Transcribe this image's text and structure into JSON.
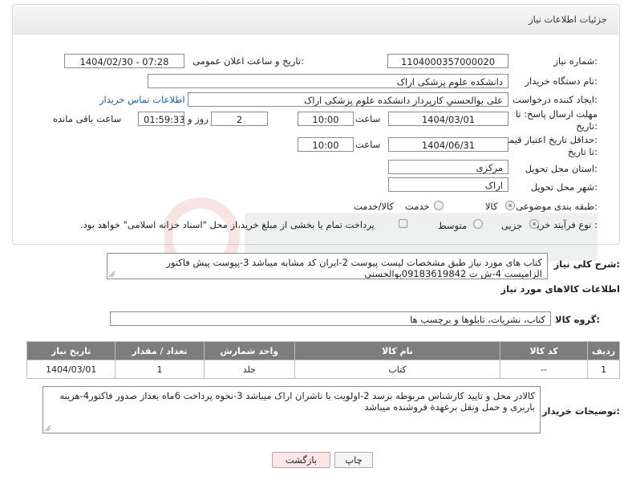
{
  "header": {
    "title": "جزئیات اطلاعات نیاز"
  },
  "form": {
    "need_number": {
      "label": "شماره نیاز:",
      "value": "1104000357000020"
    },
    "announce": {
      "label": "تاریخ و ساعت اعلان عمومی:",
      "value": "1404/02/30 - 07:28"
    },
    "buyer_org": {
      "label": "نام دستگاه خریدار:",
      "value": "دانشکده علوم پزشکی اراک"
    },
    "requester": {
      "label": "ایجاد کننده درخواست:",
      "value": "علی بوالحسني کارپرداز دانشکده علوم پزشکی اراک",
      "contact_link": "اطلاعات تماس خریدار"
    },
    "reply_deadline": {
      "label_line1": "مهلت ارسال پاسخ: تا",
      "label_line2": "تاریخ:",
      "date": "1404/03/01",
      "time_label": "ساعت",
      "time": "10:00",
      "days": "2",
      "days_label": "روز و",
      "remaining": "01:59:33",
      "remaining_label": "ساعت باقی مانده"
    },
    "price_validity": {
      "label_line1": "حداقل تاریخ اعتبار قیمت:",
      "label_line2": "تا تاریخ:",
      "date": "1404/06/31",
      "time_label": "ساعت",
      "time": "10:00"
    },
    "province": {
      "label": "استان محل تحویل:",
      "value": "مرکزی"
    },
    "city": {
      "label": "شهر محل تحویل:",
      "value": "اراک"
    },
    "category": {
      "label": "طبقه بندی موضوعی:",
      "options": [
        "کالا",
        "خدمت",
        "کالا/خدمت"
      ],
      "selected": "کالا"
    },
    "process": {
      "label": "نوع فرآیند خرید :",
      "options": [
        "جزیی",
        "متوسط"
      ],
      "selected": "جزیی",
      "payment_note": "پرداخت تمام یا بخشی از مبلغ خرید،از محل \"اسناد خزانه اسلامی\" خواهد بود."
    }
  },
  "description": {
    "label": "شرح کلی نیاز:",
    "line1": "کتاب های مورد نیاز  طبق مشخصات لیست پیوست 2-ایران کد مشابه میباشد 3-پیوست پیش فاکتور",
    "line2": "الزامیست 4-ش ت 09183619842بوالحسنی"
  },
  "goods": {
    "section_title": "اطلاعات کالاهای مورد نیاز",
    "group_label": "گروه کالا:",
    "group_value": "کتاب، نشریات، تابلوها و برچسب ها",
    "columns": [
      "ردیف",
      "کد کالا",
      "نام کالا",
      "واحد شمارش",
      "تعداد / مقدار",
      "تاریخ نیاز"
    ],
    "rows": [
      [
        "1",
        "--",
        "کتاب",
        "جلد",
        "1",
        "1404/03/01"
      ]
    ]
  },
  "buyer_notes": {
    "label": "توضیحات خریدار:",
    "line1": "کالادر محل و تایید کارشناس مربوطه برسد 2-اولویت با ناشران اراک میباشد 3-نحوه پرداخت 6ماه بعداز صدور فاکتور4-هزینه",
    "line2": "باربری و حمل ونقل برعهدة فروشنده میباشد"
  },
  "buttons": {
    "print": "چاپ",
    "back": "بازگشت"
  },
  "colors": {
    "header_bg": "#ececec",
    "table_head": "#7d7d7d",
    "back_btn": "#ffe6e6",
    "link": "#1a5fa8"
  }
}
